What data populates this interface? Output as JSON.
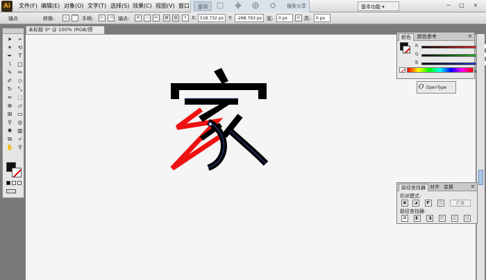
{
  "app": {
    "logo": "Ai"
  },
  "menu": [
    {
      "label": "文件(F)"
    },
    {
      "label": "编辑(E)"
    },
    {
      "label": "对象(O)"
    },
    {
      "label": "文字(T)"
    },
    {
      "label": "选择(S)"
    },
    {
      "label": "效果(C)"
    },
    {
      "label": "视图(V)"
    },
    {
      "label": "窗口"
    }
  ],
  "mode_strip": {
    "selected": "基调",
    "right": "搜索分享"
  },
  "workspace": {
    "label": "基本功能",
    "arrow": "▾"
  },
  "window_controls": {
    "min": "−",
    "max": "□",
    "close": "×"
  },
  "control_bar": {
    "anchor_label": "锚点",
    "convert_label": "转换:",
    "handles_label": "手柄:",
    "anchor_point_label": "锚点:",
    "x_value": "518.732 px",
    "y_value": "-268.763 px",
    "w_value": "0 px",
    "h_value": "0 px",
    "w_label": "宽:",
    "h_label": "高:"
  },
  "document": {
    "tab_label": "未标题-3* @ 100% (RGB/预览)",
    "close": "×"
  },
  "color_panel": {
    "tabs": [
      "颜色",
      "颜色参考"
    ],
    "channels": [
      {
        "name": "R",
        "color": "#e02020"
      },
      {
        "name": "G",
        "color": "#20b020"
      },
      {
        "name": "B",
        "color": "#2030d0"
      }
    ]
  },
  "opentype_panel": {
    "glyph": "O",
    "label": "OpenType"
  },
  "pathfinder_panel": {
    "tabs": [
      "路径查找器",
      "对齐",
      "变换"
    ],
    "shape_modes_label": "形状模式:",
    "pathfinders_label": "路径查找器:",
    "expand_label": "扩展"
  },
  "artwork": {
    "text_color": "#000000",
    "stroke_color": "#ee1111",
    "selection_color": "#3b5fc8"
  },
  "colors": {
    "accent": "#3b5fc8"
  }
}
